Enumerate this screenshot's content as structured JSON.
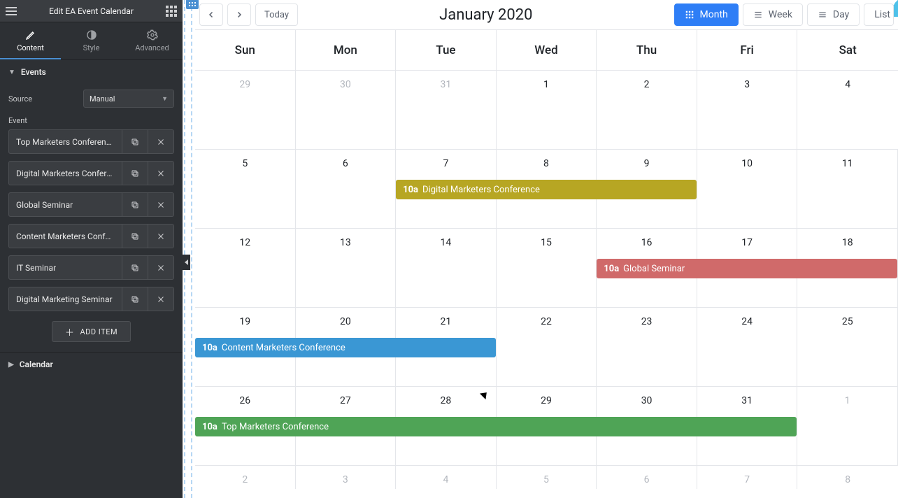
{
  "header": {
    "title": "Edit EA Event Calendar"
  },
  "tabs": {
    "content": "Content",
    "style": "Style",
    "advanced": "Advanced",
    "active": "content"
  },
  "sections": {
    "events": "Events",
    "calendar": "Calendar"
  },
  "source": {
    "label": "Source",
    "value": "Manual"
  },
  "event_label": "Event",
  "events": [
    {
      "name": "Top Marketers Conference"
    },
    {
      "name": "Digital Marketers Confere…"
    },
    {
      "name": "Global Seminar"
    },
    {
      "name": "Content Marketers Confe…"
    },
    {
      "name": "IT Seminar"
    },
    {
      "name": "Digital Marketing Seminar"
    }
  ],
  "add_item": "ADD ITEM",
  "calendar": {
    "title": "January 2020",
    "today": "Today",
    "views": {
      "month": "Month",
      "week": "Week",
      "day": "Day",
      "list": "List",
      "active": "month"
    },
    "dow": [
      "Sun",
      "Mon",
      "Tue",
      "Wed",
      "Thu",
      "Fri",
      "Sat"
    ],
    "weeks": [
      {
        "days": [
          {
            "n": "29",
            "other": true
          },
          {
            "n": "30",
            "other": true
          },
          {
            "n": "31",
            "other": true
          },
          {
            "n": "1"
          },
          {
            "n": "2"
          },
          {
            "n": "3"
          },
          {
            "n": "4"
          }
        ]
      },
      {
        "days": [
          {
            "n": "5"
          },
          {
            "n": "6"
          },
          {
            "n": "7"
          },
          {
            "n": "8"
          },
          {
            "n": "9"
          },
          {
            "n": "10"
          },
          {
            "n": "11"
          }
        ],
        "events": [
          {
            "time": "10a",
            "title": "Digital Marketers Conference",
            "color": "#b7a623",
            "start": 2,
            "span": 3
          }
        ]
      },
      {
        "days": [
          {
            "n": "12"
          },
          {
            "n": "13"
          },
          {
            "n": "14"
          },
          {
            "n": "15"
          },
          {
            "n": "16"
          },
          {
            "n": "17"
          },
          {
            "n": "18"
          }
        ],
        "events": [
          {
            "time": "10a",
            "title": "Global Seminar",
            "color": "#d06a6a",
            "start": 4,
            "span": 3
          }
        ]
      },
      {
        "days": [
          {
            "n": "19"
          },
          {
            "n": "20"
          },
          {
            "n": "21"
          },
          {
            "n": "22"
          },
          {
            "n": "23"
          },
          {
            "n": "24"
          },
          {
            "n": "25"
          }
        ],
        "events": [
          {
            "time": "10a",
            "title": "Content Marketers Conference",
            "color": "#3a97d4",
            "start": 0,
            "span": 3
          }
        ]
      },
      {
        "days": [
          {
            "n": "26"
          },
          {
            "n": "27"
          },
          {
            "n": "28"
          },
          {
            "n": "29"
          },
          {
            "n": "30"
          },
          {
            "n": "31"
          },
          {
            "n": "1",
            "other": true
          }
        ],
        "events": [
          {
            "time": "10a",
            "title": "Top Marketers Conference",
            "color": "#4fa456",
            "start": 0,
            "span": 6
          }
        ]
      },
      {
        "short": true,
        "days": [
          {
            "n": "2",
            "other": true
          },
          {
            "n": "3",
            "other": true
          },
          {
            "n": "4",
            "other": true
          },
          {
            "n": "5",
            "other": true
          },
          {
            "n": "6",
            "other": true
          },
          {
            "n": "7",
            "other": true
          },
          {
            "n": "8",
            "other": true
          }
        ]
      }
    ]
  }
}
